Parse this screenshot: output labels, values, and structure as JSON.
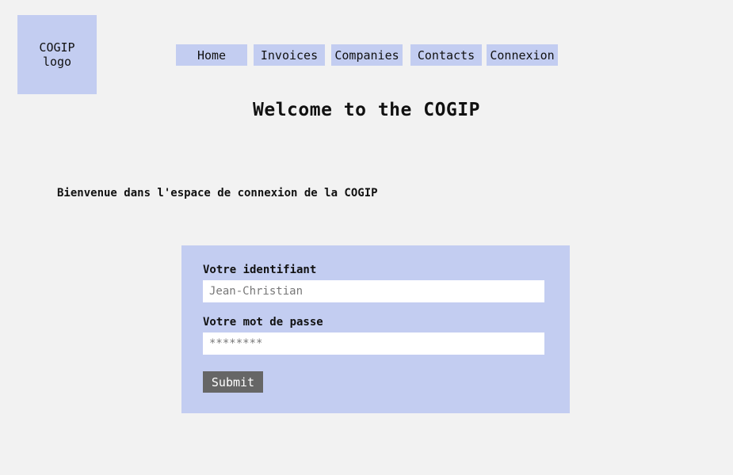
{
  "logo": {
    "line1": "COGIP",
    "line2": "logo"
  },
  "nav": {
    "items": [
      {
        "label": "Home"
      },
      {
        "label": "Invoices"
      },
      {
        "label": "Companies"
      },
      {
        "label": "Contacts"
      },
      {
        "label": "Connexion"
      }
    ]
  },
  "page": {
    "title": "Welcome to the COGIP",
    "subtitle": "Bienvenue dans l'espace de connexion de la COGIP"
  },
  "form": {
    "username_label": "Votre identifiant",
    "username_placeholder": "Jean-Christian",
    "password_label": "Votre mot de passe",
    "password_placeholder": "********",
    "submit_label": "Submit"
  },
  "colors": {
    "background": "#f2f2f2",
    "accent": "#c3cdf1",
    "button": "#666666"
  }
}
